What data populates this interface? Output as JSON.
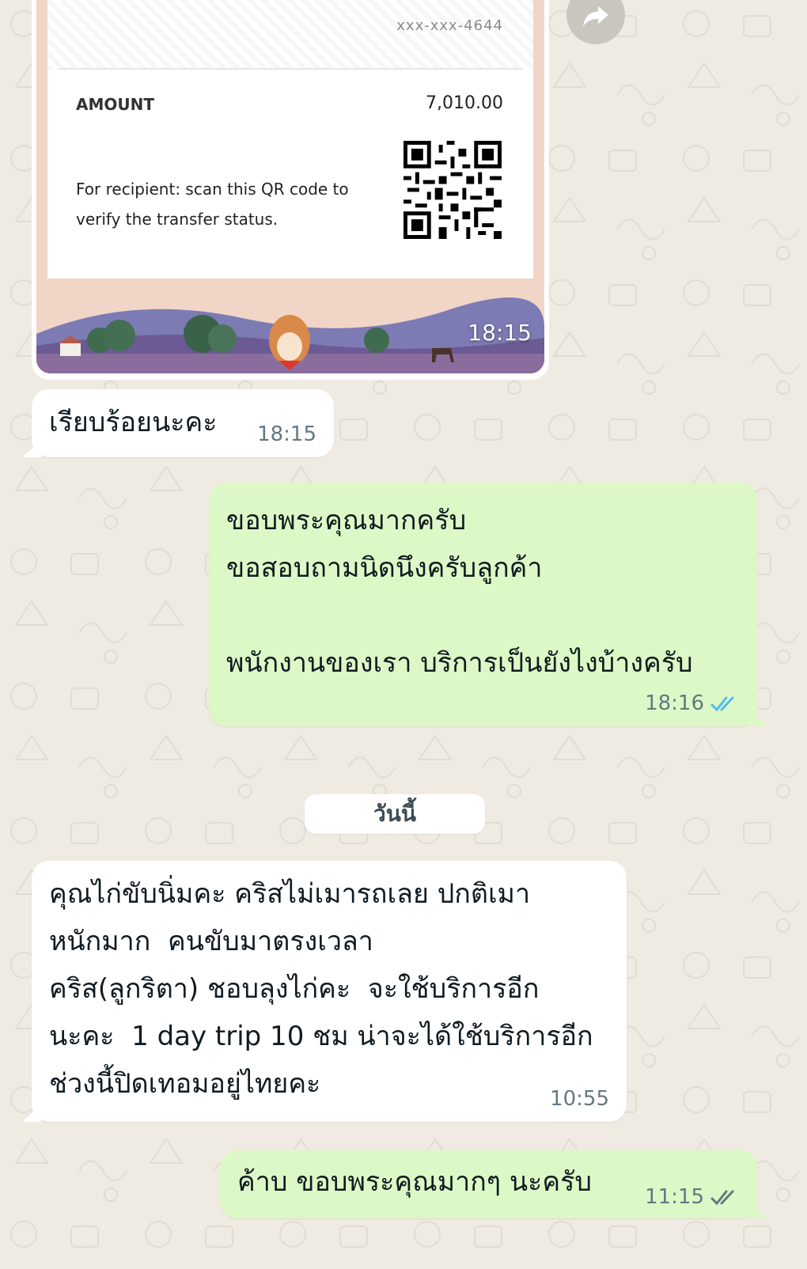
{
  "receipt": {
    "account_masked": "xxx-xxx-4644",
    "amount_label": "AMOUNT",
    "amount_value": "7,010.00",
    "verify_text": "For recipient: scan this QR code to verify the transfer status.",
    "time": "18:15"
  },
  "messages": [
    {
      "direction": "in",
      "text": "เรียบร้อยนะคะ",
      "time": "18:15"
    },
    {
      "direction": "out",
      "text": "ขอบพระคุณมากครับ\nขอสอบถามนิดนึงครับลูกค้า\n\nพนักงานของเรา บริการเป็นยังไงบ้างครับ",
      "time": "18:16",
      "status": "read"
    },
    {
      "direction": "in",
      "text": "คุณไก่ขับนิ่มคะ คริสไม่เมารถเลย ปกติเมา\nหนักมาก  คนขับมาตรงเวลา\nคริส(ลูกริตา) ชอบลุงไก่คะ  จะใช้บริการอีก\nนะคะ  1 day trip 10 ชม น่าจะได้ใช้บริการอีก\nช่วงนี้ปิดเทอมอยู่ไทยคะ",
      "time": "10:55"
    },
    {
      "direction": "out",
      "text": "ค้าบ ขอบพระคุณมากๆ นะครับ",
      "time": "11:15",
      "status": "delivered"
    }
  ],
  "date_separator": "วันนี้",
  "icons": {
    "forward": "forward-icon",
    "read_ticks_color": "#53bdeb",
    "delivered_ticks_color": "#667781"
  },
  "colors": {
    "background": "#efeae2",
    "incoming_bubble": "#ffffff",
    "outgoing_bubble": "#dcf8c6"
  }
}
